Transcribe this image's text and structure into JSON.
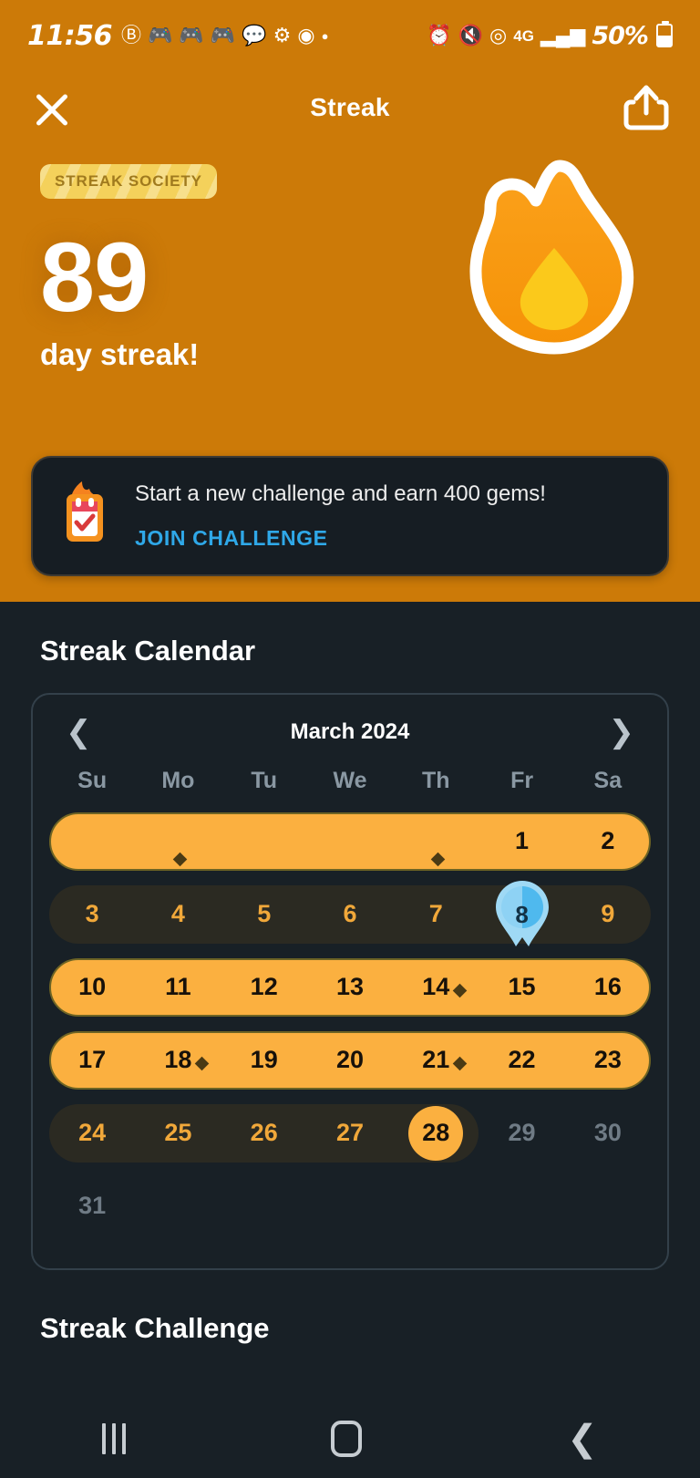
{
  "status_bar": {
    "time": "11:56",
    "icons": [
      "circle-b-icon",
      "game-controller-icon",
      "game-controller-icon",
      "game-controller-icon",
      "chat-bubble-icon",
      "gear-icon",
      "chrome-icon",
      "dot-icon",
      "alarm-icon",
      "mute-icon",
      "hotspot-icon",
      "4g-icon",
      "signal-bars-icon"
    ],
    "battery_percent": "50%"
  },
  "appbar": {
    "title": "Streak",
    "close_icon": "close-icon",
    "share_icon": "share-icon"
  },
  "hero": {
    "badge": "STREAK SOCIETY",
    "streak_count": "89",
    "streak_label": "day streak!",
    "flame_icon": "flame-icon",
    "bg_color": "#CC7A08"
  },
  "challenge_card": {
    "icon": "calendar-flame-check-icon",
    "message": "Start a new challenge and earn 400 gems!",
    "cta": "JOIN CHALLENGE",
    "cta_color": "#2FA8E8"
  },
  "calendar": {
    "section_title": "Streak Calendar",
    "month": "March 2024",
    "prev_icon": "chevron-left-icon",
    "next_icon": "chevron-right-icon",
    "dow": [
      "Su",
      "Mo",
      "Tu",
      "We",
      "Th",
      "Fr",
      "Sa"
    ],
    "accent_orange": "#FBB040",
    "weeks": [
      {
        "pill": {
          "type": "orange",
          "start": 0,
          "end": 6
        },
        "days": [
          {
            "label": "",
            "state": "blank",
            "dot": false
          },
          {
            "label": "",
            "state": "blank",
            "dot": true
          },
          {
            "label": "",
            "state": "blank",
            "dot": false
          },
          {
            "label": "",
            "state": "blank",
            "dot": false
          },
          {
            "label": "",
            "state": "blank",
            "dot": true
          },
          {
            "label": "1",
            "state": "on",
            "dot": false
          },
          {
            "label": "2",
            "state": "on",
            "dot": false
          }
        ]
      },
      {
        "pill": {
          "type": "dark",
          "start": 0,
          "end": 6
        },
        "days": [
          {
            "label": "3",
            "state": "off",
            "dot": false
          },
          {
            "label": "4",
            "state": "off",
            "dot": false
          },
          {
            "label": "5",
            "state": "off",
            "dot": false
          },
          {
            "label": "6",
            "state": "off",
            "dot": false
          },
          {
            "label": "7",
            "state": "off",
            "dot": false
          },
          {
            "label": "8",
            "state": "pin",
            "dot": false
          },
          {
            "label": "9",
            "state": "off",
            "dot": false
          }
        ]
      },
      {
        "pill": {
          "type": "orange",
          "start": 0,
          "end": 6
        },
        "days": [
          {
            "label": "10",
            "state": "on",
            "dot": false
          },
          {
            "label": "11",
            "state": "on",
            "dot": false
          },
          {
            "label": "12",
            "state": "on",
            "dot": false
          },
          {
            "label": "13",
            "state": "on",
            "dot": false
          },
          {
            "label": "14",
            "state": "on",
            "dot": true
          },
          {
            "label": "15",
            "state": "on",
            "dot": false
          },
          {
            "label": "16",
            "state": "on",
            "dot": false
          }
        ]
      },
      {
        "pill": {
          "type": "orange",
          "start": 0,
          "end": 6
        },
        "days": [
          {
            "label": "17",
            "state": "on",
            "dot": false
          },
          {
            "label": "18",
            "state": "on",
            "dot": true
          },
          {
            "label": "19",
            "state": "on",
            "dot": false
          },
          {
            "label": "20",
            "state": "on",
            "dot": false
          },
          {
            "label": "21",
            "state": "on",
            "dot": true
          },
          {
            "label": "22",
            "state": "on",
            "dot": false
          },
          {
            "label": "23",
            "state": "on",
            "dot": false
          }
        ]
      },
      {
        "pill": {
          "type": "dark",
          "start": 0,
          "end": 4
        },
        "days": [
          {
            "label": "24",
            "state": "off",
            "dot": false
          },
          {
            "label": "25",
            "state": "off",
            "dot": false
          },
          {
            "label": "26",
            "state": "off",
            "dot": false
          },
          {
            "label": "27",
            "state": "off",
            "dot": false
          },
          {
            "label": "28",
            "state": "today",
            "dot": false
          },
          {
            "label": "29",
            "state": "future",
            "dot": false
          },
          {
            "label": "30",
            "state": "future",
            "dot": false
          }
        ]
      },
      {
        "pill": null,
        "days": [
          {
            "label": "31",
            "state": "future",
            "dot": false
          },
          {
            "label": "",
            "state": "blank",
            "dot": false
          },
          {
            "label": "",
            "state": "blank",
            "dot": false
          },
          {
            "label": "",
            "state": "blank",
            "dot": false
          },
          {
            "label": "",
            "state": "blank",
            "dot": false
          },
          {
            "label": "",
            "state": "blank",
            "dot": false
          },
          {
            "label": "",
            "state": "blank",
            "dot": false
          }
        ]
      }
    ]
  },
  "streak_challenge": {
    "section_title": "Streak Challenge"
  },
  "navbar": {
    "recents_icon": "recents-icon",
    "home_icon": "home-icon",
    "back_icon": "back-icon"
  }
}
